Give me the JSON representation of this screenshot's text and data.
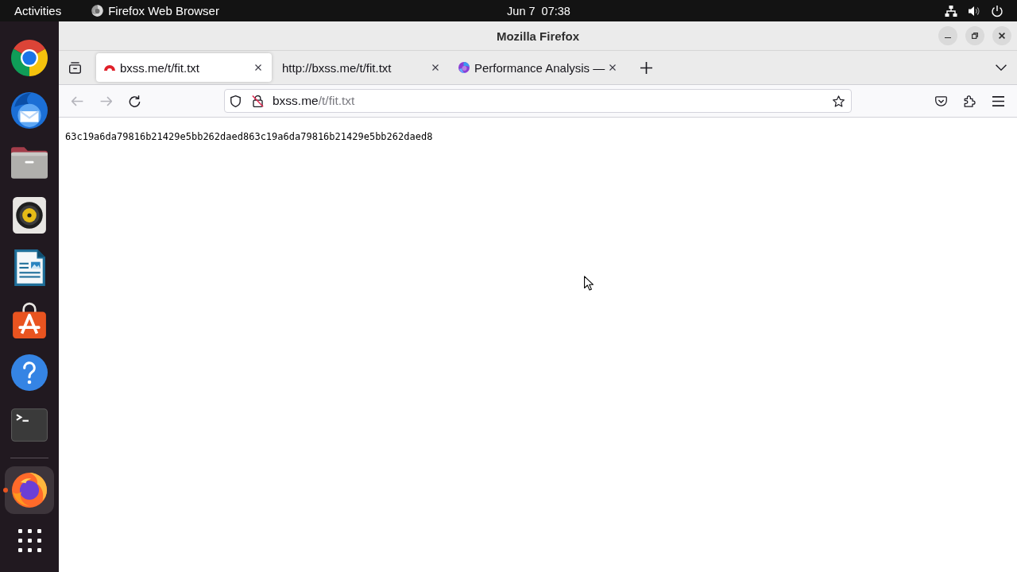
{
  "top_bar": {
    "activities": "Activities",
    "app_menu": "Firefox Web Browser",
    "clock": "Jun 7  07:38"
  },
  "dock": {
    "pinned": [
      {
        "running": false,
        "focused": false
      },
      {
        "running": false,
        "focused": false
      },
      {
        "running": false,
        "focused": false
      },
      {
        "running": false,
        "focused": false
      },
      {
        "running": false,
        "focused": false
      },
      {
        "running": false,
        "focused": false
      },
      {
        "running": false,
        "focused": false
      },
      {
        "running": false,
        "focused": false
      }
    ],
    "open": [
      {
        "running": true,
        "focused": true
      }
    ]
  },
  "window": {
    "title": "Mozilla Firefox"
  },
  "tabs": [
    {
      "label": "bxss.me/t/fit.txt",
      "selected": true,
      "kind": "site"
    },
    {
      "label": "http://bxss.me/t/fit.txt",
      "selected": false,
      "kind": "plain"
    },
    {
      "label": "Performance Analysis —",
      "selected": false,
      "kind": "browser"
    }
  ],
  "toolbar": {
    "back": {
      "disabled": true
    },
    "forward": {
      "disabled": true
    },
    "url": {
      "host": "bxss.me",
      "path": "/t/fit.txt"
    }
  },
  "page": {
    "text": "63c19a6da79816b21429e5bb262daed863c19a6da79816b21429e5bb262daed8"
  }
}
